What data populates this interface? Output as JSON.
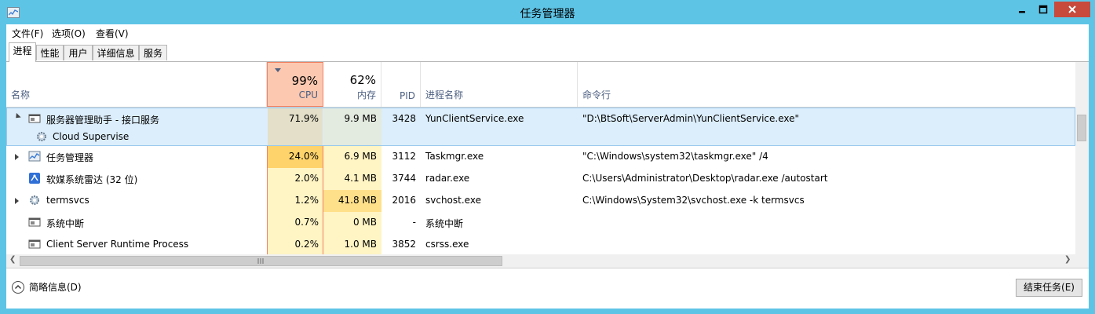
{
  "window": {
    "title": "任务管理器"
  },
  "menu": [
    "文件(F)",
    "选项(O)",
    "查看(V)"
  ],
  "tabs": [
    {
      "label": "进程",
      "active": true
    },
    {
      "label": "性能",
      "active": false
    },
    {
      "label": "用户",
      "active": false
    },
    {
      "label": "详细信息",
      "active": false
    },
    {
      "label": "服务",
      "active": false
    }
  ],
  "columns": {
    "name": "名称",
    "cpu": {
      "percent": "99%",
      "label": "CPU"
    },
    "memory": {
      "percent": "62%",
      "label": "内存"
    },
    "pid": "PID",
    "process_name": "进程名称",
    "command_line": "命令行"
  },
  "rows": [
    {
      "name": "服务器管理助手 - 接口服务",
      "cpu": "71.9%",
      "memory": "9.9 MB",
      "pid": "3428",
      "process_name": "YunClientService.exe",
      "command_line": "\"D:\\BtSoft\\ServerAdmin\\YunClientService.exe\"",
      "expanded": true,
      "icon": "service-window-icon",
      "child": {
        "name": "Cloud Supervise",
        "icon": "gear-icon"
      }
    },
    {
      "name": "任务管理器",
      "cpu": "24.0%",
      "memory": "6.9 MB",
      "pid": "3112",
      "process_name": "Taskmgr.exe",
      "command_line": "\"C:\\Windows\\system32\\taskmgr.exe\" /4",
      "expanded": false,
      "icon": "task-manager-icon"
    },
    {
      "name": "软媒系统雷达 (32 位)",
      "cpu": "2.0%",
      "memory": "4.1 MB",
      "pid": "3744",
      "process_name": "radar.exe",
      "command_line": "C:\\Users\\Administrator\\Desktop\\radar.exe /autostart",
      "icon": "radar-app-icon"
    },
    {
      "name": "termsvcs",
      "cpu": "1.2%",
      "memory": "41.8 MB",
      "pid": "2016",
      "process_name": "svchost.exe",
      "command_line": "C:\\Windows\\System32\\svchost.exe -k termsvcs",
      "expanded": false,
      "icon": "gear-icon"
    },
    {
      "name": "系统中断",
      "cpu": "0.7%",
      "memory": "0 MB",
      "pid": "-",
      "process_name": "系统中断",
      "command_line": "",
      "icon": "service-window-icon"
    },
    {
      "name": "Client Server Runtime Process",
      "cpu": "0.2%",
      "memory": "1.0 MB",
      "pid": "3852",
      "process_name": "csrss.exe",
      "command_line": "",
      "icon": "service-window-icon"
    }
  ],
  "footer": {
    "fewer_details": "简略信息(D)",
    "end_task": "结束任务(E)"
  },
  "colors": {
    "titlebar": "#5ec4e6",
    "close_button": "#c74a3c",
    "cpu_heat_high": "#ffd36b",
    "cpu_heat_low": "#fff4c4",
    "sorted_header": "#fcc8b0",
    "selection": "#dceefb"
  }
}
